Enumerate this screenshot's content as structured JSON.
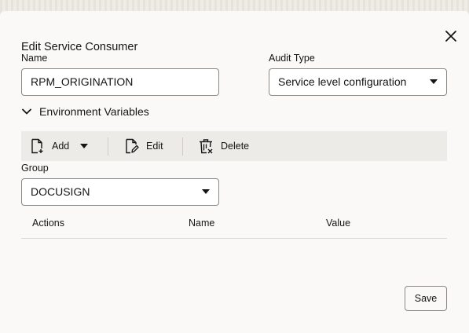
{
  "dialog": {
    "title": "Edit Service Consumer",
    "close_icon": "close-icon"
  },
  "form": {
    "name_label": "Name",
    "name_value": "RPM_ORIGINATION",
    "audit_type_label": "Audit Type",
    "audit_type_value": "Service level configuration"
  },
  "env_section": {
    "toggle_icon": "chevron-down-icon",
    "label": "Environment Variables"
  },
  "toolbar": {
    "add_label": "Add",
    "edit_label": "Edit",
    "delete_label": "Delete"
  },
  "group": {
    "label": "Group",
    "value": "DOCUSIGN"
  },
  "table": {
    "columns": [
      "Actions",
      "Name",
      "Value"
    ]
  },
  "footer": {
    "save_label": "Save"
  },
  "colors": {
    "dialog_bg": "#fbf9f8",
    "toolbar_bg": "#edebe7",
    "border": "#8b8884",
    "text": "#161513"
  }
}
